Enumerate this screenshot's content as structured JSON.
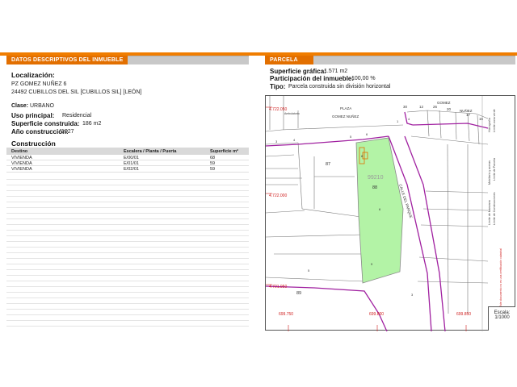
{
  "left": {
    "section_title_prefix": "DATOS DESCRIPTIVOS DEL ",
    "section_title_emph": "INMUEBLE",
    "localizacion_label": "Localización:",
    "address_line1": "PZ GOMEZ NUÑEZ 6",
    "address_line2": "24492 CUBILLOS DEL SIL [CUBILLOS SIL] [LEÓN]",
    "clase_label": "Clase:",
    "clase_value": "URBANO",
    "uso_label": "Uso principal:",
    "uso_value": "Residencial",
    "superficie_label": "Superficie construida:",
    "superficie_value": "186 m2",
    "anio_label": "Año construcción:",
    "anio_value": "1927",
    "construccion_title": "Construcción",
    "table": {
      "headers": [
        "Destino",
        "Escalera / Planta / Puerta",
        "Superficie m²"
      ],
      "rows": [
        [
          "VIVIENDA",
          "E/00/01",
          "68"
        ],
        [
          "VIVIENDA",
          "E/01/01",
          "59"
        ],
        [
          "VIVIENDA",
          "E/02/01",
          "59"
        ]
      ]
    }
  },
  "right": {
    "section_title": "PARCELA",
    "sup_grafica_label": "Superficie gráfica:",
    "sup_grafica_value": "1.571 m2",
    "participacion_label": "Participación del inmueble:",
    "participacion_value": "100,00 %",
    "tipo_label": "Tipo:",
    "tipo_value": "Parcela construida sin división horizontal"
  },
  "map": {
    "labels": {
      "plaza": "PLAZA",
      "gomez_nunez": "GOMEZ NUÑEZ",
      "gomez_top": "GOMEZ",
      "nunez_top": "NUÑEZ",
      "calle": "CALLE DEL PARQUE",
      "coord_y1": "4.722.050",
      "coord_y2": "4.722.000",
      "coord_y3": "4.721.950",
      "coord_x1": "699.750",
      "coord_x2": "699.800",
      "coord_x3": "699.850",
      "parcel_ref": "99210",
      "p88": "88",
      "p87": "87",
      "p89": "89",
      "n30": "30",
      "n12": "12",
      "n26": "26",
      "n20": "20",
      "n17": "17",
      "n16": "16",
      "n3": "3",
      "n4": "4",
      "n5": "5",
      "n6": "6",
      "n8": "8",
      "n1": "1",
      "n4b": "4",
      "n6b": "6",
      "n9": "9",
      "n5b": "5",
      "n3b": "3",
      "small_label": "Ambulatorio",
      "side1": "Límite de Manzana",
      "side2": "Límite de Parcela",
      "side3": "Límite de Construcciones",
      "side4": "Mobiliario y aceras",
      "side5": "Límite zona verde",
      "side6": "Hidrografía"
    },
    "side_red_text": "Este documento no es una certificación catastral",
    "colors": {
      "parcel_fill": "#b3f3a6",
      "limit": "#a020a0",
      "coord": "#d02020"
    }
  },
  "scale": {
    "label": "Escala:",
    "value": "1/1000"
  }
}
